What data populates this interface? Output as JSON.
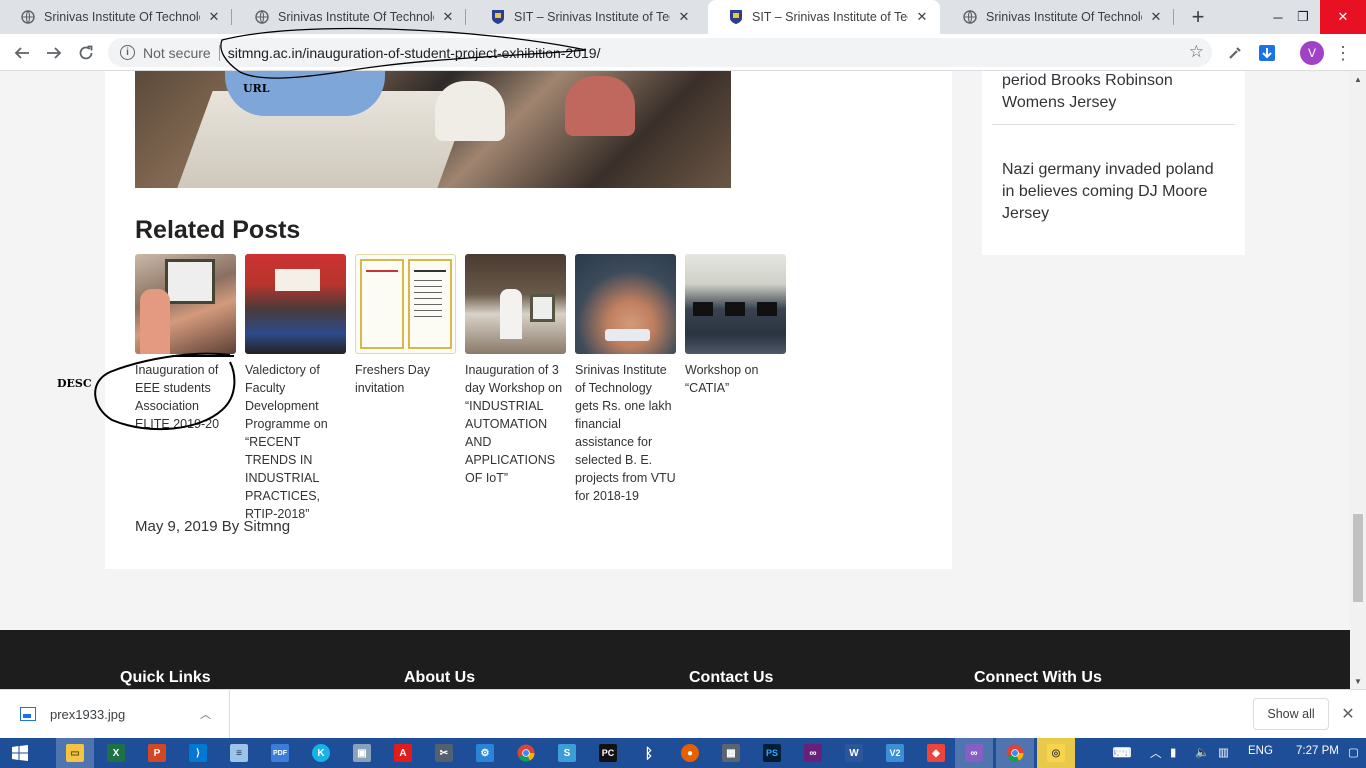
{
  "browser": {
    "tabs": [
      {
        "title": "Srinivas Institute Of Technology",
        "favicon": "globe-icon",
        "active": false
      },
      {
        "title": "Srinivas Institute Of Technology",
        "favicon": "globe-icon",
        "active": false
      },
      {
        "title": "SIT – Srinivas Institute of Techno",
        "favicon": "college-crest-icon",
        "active": false
      },
      {
        "title": "SIT – Srinivas Institute of Techno",
        "favicon": "college-crest-icon",
        "active": true
      },
      {
        "title": "Srinivas Institute Of Technology",
        "favicon": "globe-icon",
        "active": false
      }
    ],
    "omnibox": {
      "security_label": "Not secure",
      "url": "sitmng.ac.in/inauguration-of-student-project-exhibition-2019/"
    },
    "profile_initial": "V"
  },
  "page": {
    "related_title": "Related Posts",
    "related_posts": [
      {
        "caption": "Inauguration of EEE students Association ELITE 2019-20",
        "thumb": "lamp-lighting-photo"
      },
      {
        "caption": "Valedictory of Faculty Development Programme on “RECENT TRENDS IN INDUSTRIAL PRACTICES, RTIP-2018”",
        "thumb": "group-photo"
      },
      {
        "caption": "Freshers Day invitation",
        "thumb": "invitation-card"
      },
      {
        "caption": "Inauguration of 3 day Workshop on “INDUSTRIAL AUTOMATION AND APPLICATIONS OF IoT”",
        "thumb": "inauguration-photo"
      },
      {
        "caption": "Srinivas Institute of Technology gets Rs. one lakh financial assistance for selected B. E. projects from VTU for 2018-19",
        "thumb": "hands-teamwork-photo"
      },
      {
        "caption": "Workshop on “CATIA”",
        "thumb": "computer-lab-photo"
      }
    ],
    "post_meta": "May 9, 2019 By Sitmng",
    "sidebar_links": [
      "period Brooks Robinson Womens Jersey",
      "Nazi germany invaded poland in believes coming DJ Moore Jersey"
    ],
    "footer_headings": [
      "Quick Links",
      "About Us",
      "Contact Us",
      "Connect With Us"
    ]
  },
  "annotations": {
    "url_label": "URL",
    "desc_label": "DESC"
  },
  "downloads": {
    "file_name": "prex1933.jpg",
    "show_all_label": "Show all"
  },
  "taskbar": {
    "language": "ENG",
    "time": "7:27 PM"
  },
  "colors": {
    "titlebar": "#dee1e6",
    "footer": "#1d1d1d",
    "taskbar": "#1f4e99",
    "avatar": "#a142c6",
    "close_hover": "#e81123"
  }
}
